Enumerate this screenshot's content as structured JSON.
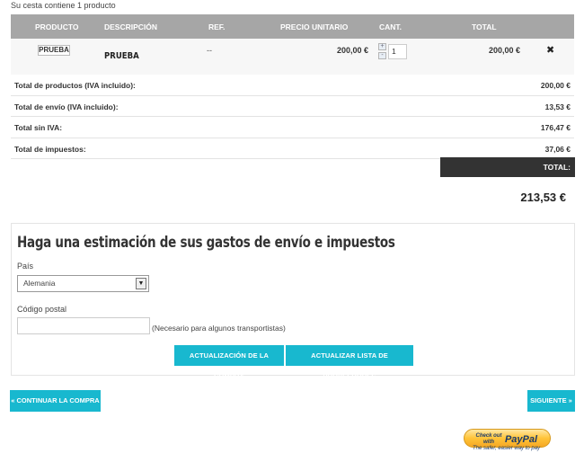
{
  "cart_summary": "Su cesta contiene 1 producto",
  "table": {
    "headers": [
      "PRODUCTO",
      "DESCRIPCIÓN",
      "REF.",
      "PRECIO UNITARIO",
      "CANT.",
      "TOTAL"
    ]
  },
  "item": {
    "thumb_label": "PRUEBA",
    "name": "PRUEBA",
    "ref": "--",
    "unit_price": "200,00 €",
    "qty": "1",
    "total": "200,00 €",
    "qty_up": "+",
    "qty_down": "-",
    "delete_icon": "close-icon",
    "delete_glyph": "✖"
  },
  "totals": [
    {
      "label": "Total de productos (IVA incluido):",
      "value": "200,00 €"
    },
    {
      "label": "Total de envío (IVA incluido):",
      "value": "13,53 €"
    },
    {
      "label": "Total sin IVA:",
      "value": "176,47 €"
    },
    {
      "label": "Total de impuestos:",
      "value": "37,06 €"
    }
  ],
  "total_label": "TOTAL:",
  "grand_total": "213,53 €",
  "estimate": {
    "title": "Haga una estimación de sus gastos de envío e impuestos",
    "country_label": "País",
    "country_value": "Alemania",
    "postal_label": "Código postal",
    "postal_value": "",
    "postal_note": "(Necesario para algunos transportistas)",
    "update_button": "ACTUALIZACIÓN DE LA COMPRA",
    "carriers_button": "ACTUALIZAR LISTA DE PROVEEDORES"
  },
  "nav": {
    "continue": "« CONTINUAR LA COMPRA",
    "next": "SIGUIENTE »"
  },
  "paypal": {
    "line1": "Check out",
    "line2": "with",
    "brand": "PayPal",
    "tagline": "The safer, easier way to pay"
  },
  "colors": {
    "accent": "#18b8cf",
    "header_bg": "#a6a6a6",
    "total_box": "#333333"
  }
}
